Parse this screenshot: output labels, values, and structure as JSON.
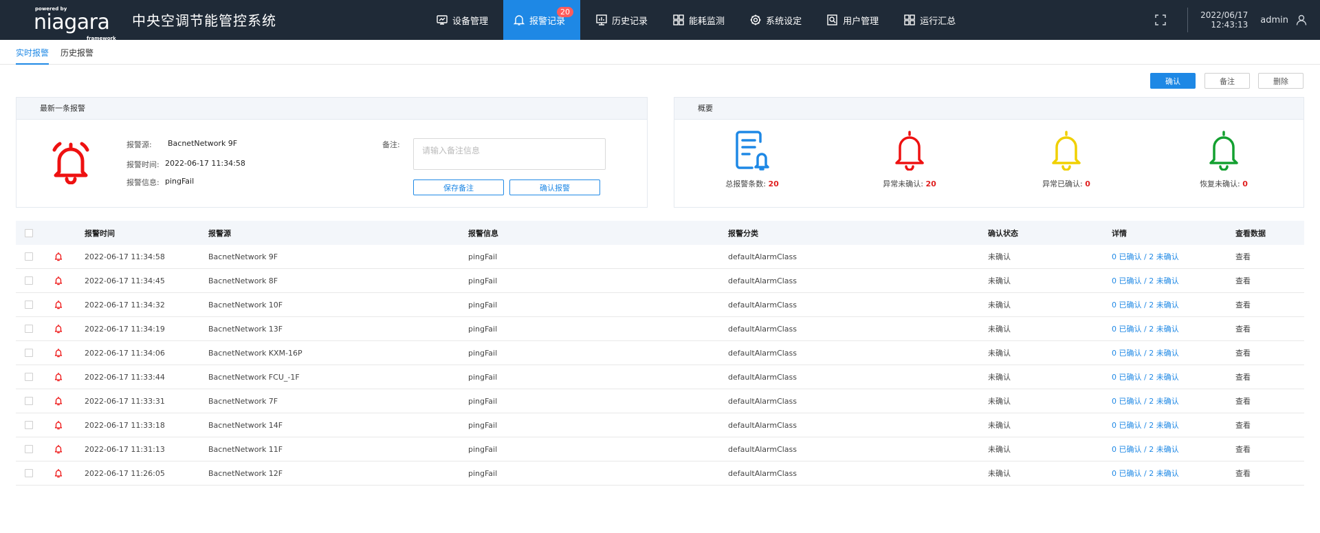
{
  "header": {
    "logo": {
      "powered_by": "powered by",
      "name": "niagara",
      "framework": "framework"
    },
    "title": "中央空调节能管控系统",
    "nav": [
      {
        "label": "设备管理",
        "icon": "monitor-icon",
        "active": false
      },
      {
        "label": "报警记录",
        "icon": "bell-icon",
        "active": true,
        "badge": "20"
      },
      {
        "label": "历史记录",
        "icon": "chart-icon",
        "active": false
      },
      {
        "label": "能耗监测",
        "icon": "grid-icon",
        "active": false
      },
      {
        "label": "系统设定",
        "icon": "gear-icon",
        "active": false
      },
      {
        "label": "用户管理",
        "icon": "user-search-icon",
        "active": false
      },
      {
        "label": "运行汇总",
        "icon": "grid-icon",
        "active": false
      }
    ],
    "date": "2022/06/17",
    "time": "12:43:13",
    "user": "admin"
  },
  "subtabs": [
    {
      "label": "实时报警",
      "active": true
    },
    {
      "label": "历史报警",
      "active": false
    }
  ],
  "actions": {
    "confirm": "确认",
    "remark": "备注",
    "delete": "删除"
  },
  "latest": {
    "title": "最新一条报警",
    "source_label": "报警源:",
    "source": "BacnetNetwork 9F",
    "time_label": "报警时间:",
    "time": "2022-06-17 11:34:58",
    "info_label": "报警信息:",
    "info": "pingFail",
    "remark_label": "备注:",
    "remark_placeholder": "请输入备注信息",
    "save_remark": "保存备注",
    "confirm_alarm": "确认报警"
  },
  "summary": {
    "title": "概要",
    "items": [
      {
        "label": "总报警条数: ",
        "value": "20",
        "icon": "document-bell-icon",
        "color": "#1e88e5"
      },
      {
        "label": "异常未确认: ",
        "value": "20",
        "icon": "bell-icon",
        "color": "#ee1111"
      },
      {
        "label": "异常已确认: ",
        "value": "0",
        "icon": "bell-icon",
        "color": "#f0d000"
      },
      {
        "label": "恢复未确认: ",
        "value": "0",
        "icon": "bell-icon",
        "color": "#13a030"
      }
    ]
  },
  "table": {
    "columns": [
      "报警时间",
      "报警源",
      "报警信息",
      "报警分类",
      "确认状态",
      "详情",
      "查看数据"
    ],
    "rows": [
      {
        "time": "2022-06-17 11:34:58",
        "source": "BacnetNetwork 9F",
        "info": "pingFail",
        "class": "defaultAlarmClass",
        "status": "未确认",
        "detail": "0 已确认 / 2 未确认",
        "view": "查看"
      },
      {
        "time": "2022-06-17 11:34:45",
        "source": "BacnetNetwork 8F",
        "info": "pingFail",
        "class": "defaultAlarmClass",
        "status": "未确认",
        "detail": "0 已确认 / 2 未确认",
        "view": "查看"
      },
      {
        "time": "2022-06-17 11:34:32",
        "source": "BacnetNetwork 10F",
        "info": "pingFail",
        "class": "defaultAlarmClass",
        "status": "未确认",
        "detail": "0 已确认 / 2 未确认",
        "view": "查看"
      },
      {
        "time": "2022-06-17 11:34:19",
        "source": "BacnetNetwork 13F",
        "info": "pingFail",
        "class": "defaultAlarmClass",
        "status": "未确认",
        "detail": "0 已确认 / 2 未确认",
        "view": "查看"
      },
      {
        "time": "2022-06-17 11:34:06",
        "source": "BacnetNetwork KXM-16P",
        "info": "pingFail",
        "class": "defaultAlarmClass",
        "status": "未确认",
        "detail": "0 已确认 / 2 未确认",
        "view": "查看"
      },
      {
        "time": "2022-06-17 11:33:44",
        "source": "BacnetNetwork FCU_-1F",
        "info": "pingFail",
        "class": "defaultAlarmClass",
        "status": "未确认",
        "detail": "0 已确认 / 2 未确认",
        "view": "查看"
      },
      {
        "time": "2022-06-17 11:33:31",
        "source": "BacnetNetwork 7F",
        "info": "pingFail",
        "class": "defaultAlarmClass",
        "status": "未确认",
        "detail": "0 已确认 / 2 未确认",
        "view": "查看"
      },
      {
        "time": "2022-06-17 11:33:18",
        "source": "BacnetNetwork 14F",
        "info": "pingFail",
        "class": "defaultAlarmClass",
        "status": "未确认",
        "detail": "0 已确认 / 2 未确认",
        "view": "查看"
      },
      {
        "time": "2022-06-17 11:31:13",
        "source": "BacnetNetwork 11F",
        "info": "pingFail",
        "class": "defaultAlarmClass",
        "status": "未确认",
        "detail": "0 已确认 / 2 未确认",
        "view": "查看"
      },
      {
        "time": "2022-06-17 11:26:05",
        "source": "BacnetNetwork 12F",
        "info": "pingFail",
        "class": "defaultAlarmClass",
        "status": "未确认",
        "detail": "0 已确认 / 2 未确认",
        "view": "查看"
      }
    ]
  }
}
